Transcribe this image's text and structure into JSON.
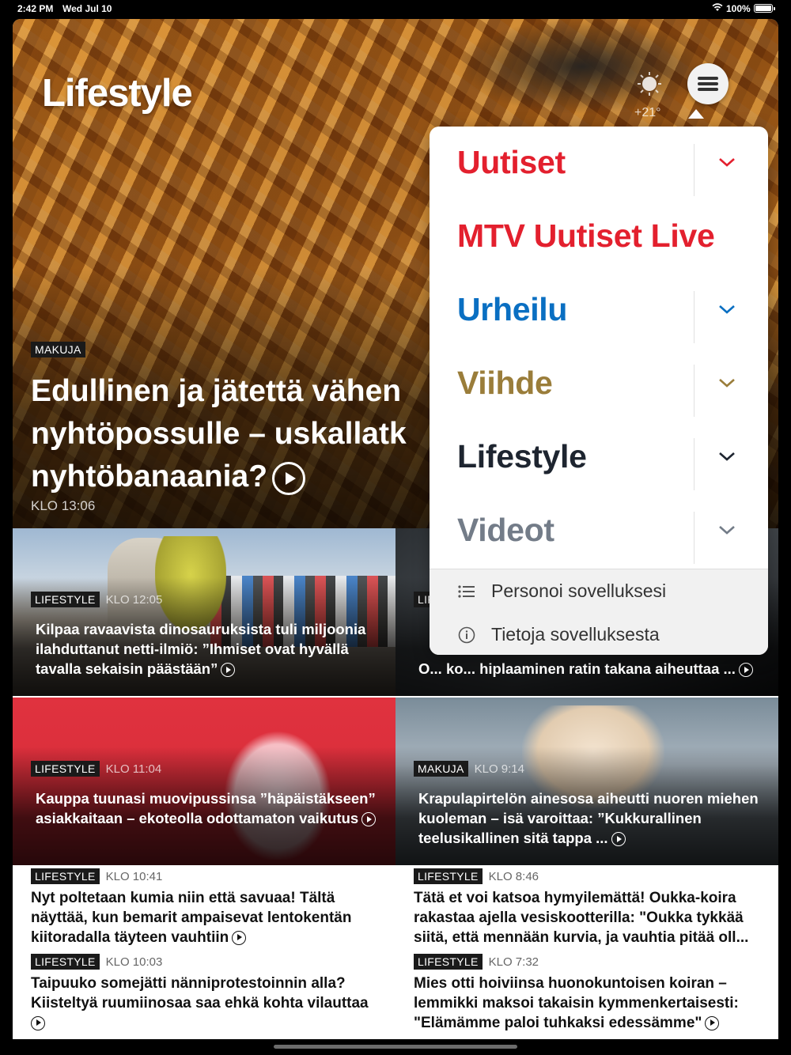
{
  "status_bar": {
    "time": "2:42 PM",
    "date": "Wed Jul 10",
    "battery": "100%"
  },
  "header": {
    "brand": "Lifestyle",
    "weather_temp": "+21°"
  },
  "hero": {
    "tag": "MAKUJA",
    "title": "Edullinen ja jätettä vähen nyhtöpossulle – uskallatk nyhtöbanaania?",
    "time": "KLO 13:06"
  },
  "cards": [
    {
      "tag": "LIFESTYLE",
      "time": "KLO 12:05",
      "title": "Kilpaa ravaavista dinosauruksista tuli miljoonia ilahduttanut netti-ilmiö: ”Ihmiset ovat hyvällä tavalla sekaisin päästään”"
    },
    {
      "tag": "LIFE",
      "time": "",
      "title": "O... ko... hiplaaminen ratin takana aiheuttaa ..."
    },
    {
      "tag": "LIFESTYLE",
      "time": "KLO 11:04",
      "title": "Kauppa tuunasi muovipussinsa ”häpäistäkseen” asiakkaitaan – ekoteolla odottamaton vaikutus"
    },
    {
      "tag": "MAKUJA",
      "time": "KLO 9:14",
      "title": "Krapulapirtelön ainesosa aiheutti nuoren miehen kuoleman – isä varoittaa: ”Kukkurallinen teelusikallinen sitä tappa ..."
    }
  ],
  "list_left": [
    {
      "tag": "LIFESTYLE",
      "time": "KLO 10:41",
      "title": "Nyt poltetaan kumia niin että savuaa! Tältä näyttää, kun bemarit ampaisevat lentokentän kiitoradalla täyteen vauhtiin"
    },
    {
      "tag": "LIFESTYLE",
      "time": "KLO 10:03",
      "title": "Taipuuko somejätti nänniprotestoinnin alla? Kiisteltyä ruumiinosaa saa ehkä kohta vilauttaa"
    }
  ],
  "list_right": [
    {
      "tag": "LIFESTYLE",
      "time": "KLO 8:46",
      "title": "Tätä et voi katsoa hymyilemättä! Oukka-koira rakastaa ajella vesiskootterilla: \"Oukka tykkää siitä, että mennään kurvia, ja vauhtia pitää oll..."
    },
    {
      "tag": "LIFESTYLE",
      "time": "KLO 7:32",
      "title": "Mies otti hoiviinsa huonokuntoisen koiran – lemmikki maksoi takaisin kymmenkertaisesti: \"Elämämme paloi tuhkaksi edessämme\""
    }
  ],
  "menu": {
    "items": [
      {
        "label": "Uutiset",
        "color": "#e3202e",
        "chevron": true
      },
      {
        "label": "MTV Uutiset Live",
        "color": "#e3202e",
        "chevron": false
      },
      {
        "label": "Urheilu",
        "color": "#0a6fc2",
        "chevron": true
      },
      {
        "label": "Viihde",
        "color": "#9a7d3a",
        "chevron": true
      },
      {
        "label": "Lifestyle",
        "color": "#1e2530",
        "chevron": true
      },
      {
        "label": "Videot",
        "color": "#737c88",
        "chevron": true
      }
    ],
    "footer": [
      {
        "label": "Personoi sovelluksesi",
        "icon": "list-icon"
      },
      {
        "label": "Tietoja sovelluksesta",
        "icon": "info-icon"
      }
    ]
  }
}
